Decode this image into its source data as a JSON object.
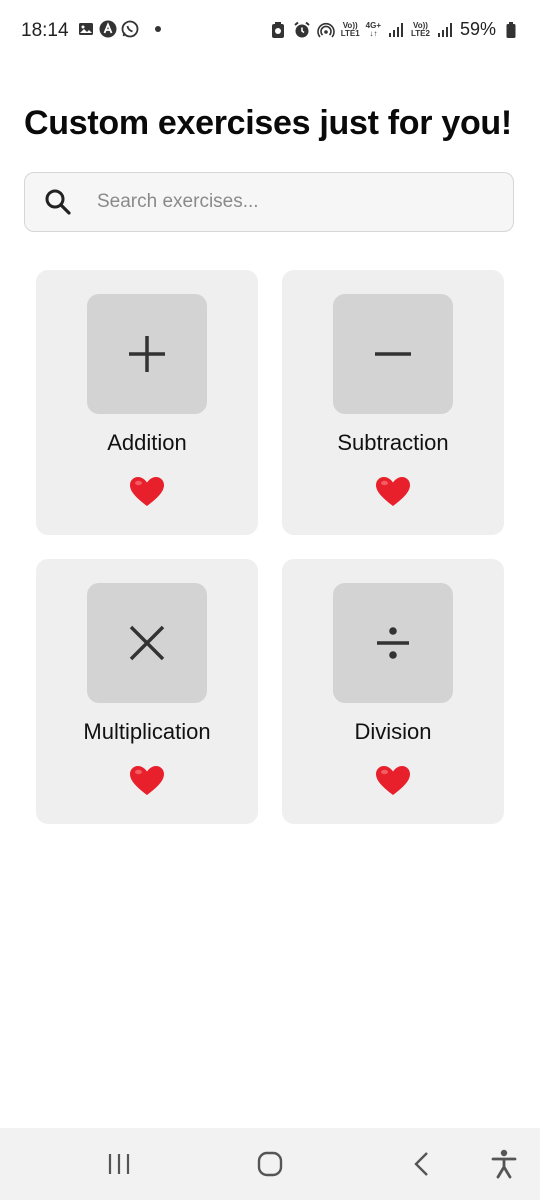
{
  "status_bar": {
    "time": "18:14",
    "left_icons": [
      "gallery-icon",
      "app-icon",
      "whatsapp-icon",
      "notification-dot"
    ],
    "right_icons": [
      "battery-saver-icon",
      "alarm-icon",
      "hotspot-icon",
      "volte-lte1",
      "4g-plus-signal",
      "volte-lte2",
      "signal-bars"
    ],
    "lte1_top": "Vo))",
    "lte1_bottom": "LTE1",
    "net_top": "4G+",
    "net_bottom": "↓↑",
    "lte2_top": "Vo))",
    "lte2_bottom": "LTE2",
    "battery": "59%"
  },
  "page": {
    "title": "Custom exercises just for you!"
  },
  "search": {
    "placeholder": "Search exercises...",
    "value": ""
  },
  "exercises": [
    {
      "label": "Addition",
      "icon": "plus-icon",
      "favorite": true
    },
    {
      "label": "Subtraction",
      "icon": "minus-icon",
      "favorite": true
    },
    {
      "label": "Multiplication",
      "icon": "multiply-icon",
      "favorite": true
    },
    {
      "label": "Division",
      "icon": "divide-icon",
      "favorite": true
    }
  ],
  "colors": {
    "card_bg": "#efefef",
    "icon_box_bg": "#d3d3d3",
    "heart": "#e8202b",
    "search_bg": "#f6f6f6"
  },
  "nav_bar": [
    "recents-icon",
    "home-icon",
    "back-icon",
    "accessibility-icon"
  ]
}
